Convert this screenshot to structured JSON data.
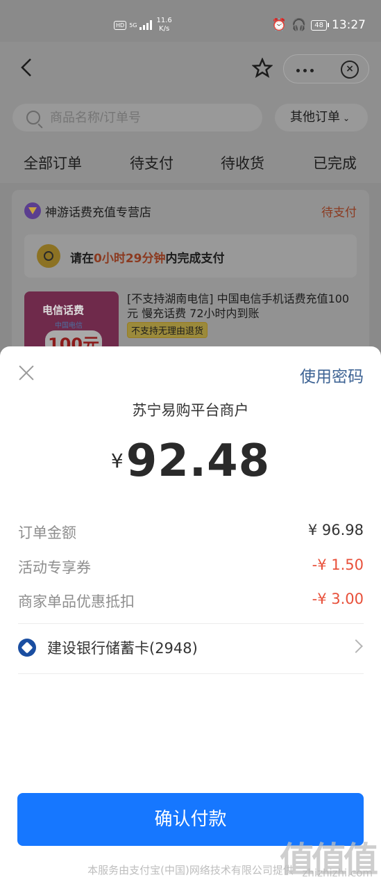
{
  "status_bar": {
    "hd": "HD",
    "network": "5G",
    "speed_value": "11.6",
    "speed_unit": "K/s",
    "battery": "48",
    "time": "13:27"
  },
  "header": {
    "search_placeholder": "商品名称/订单号",
    "other_orders_label": "其他订单"
  },
  "tabs": [
    "全部订单",
    "待支付",
    "待收货",
    "已完成"
  ],
  "order": {
    "shop_name": "神游话费充值专营店",
    "status": "待支付",
    "timer_prefix": "请在",
    "timer_highlight": "0小时29分钟",
    "timer_suffix": "内完成支付",
    "product_image_title": "电信话费",
    "product_image_brand": "中国电信",
    "product_image_value": "100元",
    "product_title": "[不支持湖南电信] 中国电信手机话费充值100元 慢充话费 72小时内到账",
    "product_tag": "不支持无理由退货"
  },
  "payment": {
    "use_password_label": "使用密码",
    "merchant": "苏宁易购平台商户",
    "currency": "¥",
    "amount": "92.48",
    "details": [
      {
        "label": "订单金额",
        "value": "¥ 96.98"
      },
      {
        "label": "活动专享券",
        "value": "-¥ 1.50"
      },
      {
        "label": "商家单品优惠抵扣",
        "value": "-¥ 3.00"
      }
    ],
    "bank_card": "建设银行储蓄卡(2948)",
    "confirm_label": "确认付款",
    "footer": "本服务由支付宝(中国)网络技术有限公司提供"
  },
  "watermark": {
    "text": "值值值",
    "site": "zhizhizhi.com"
  },
  "colors": {
    "primary_button": "#1677ff",
    "discount_red": "#e8503a",
    "link_blue": "#3d6394"
  }
}
